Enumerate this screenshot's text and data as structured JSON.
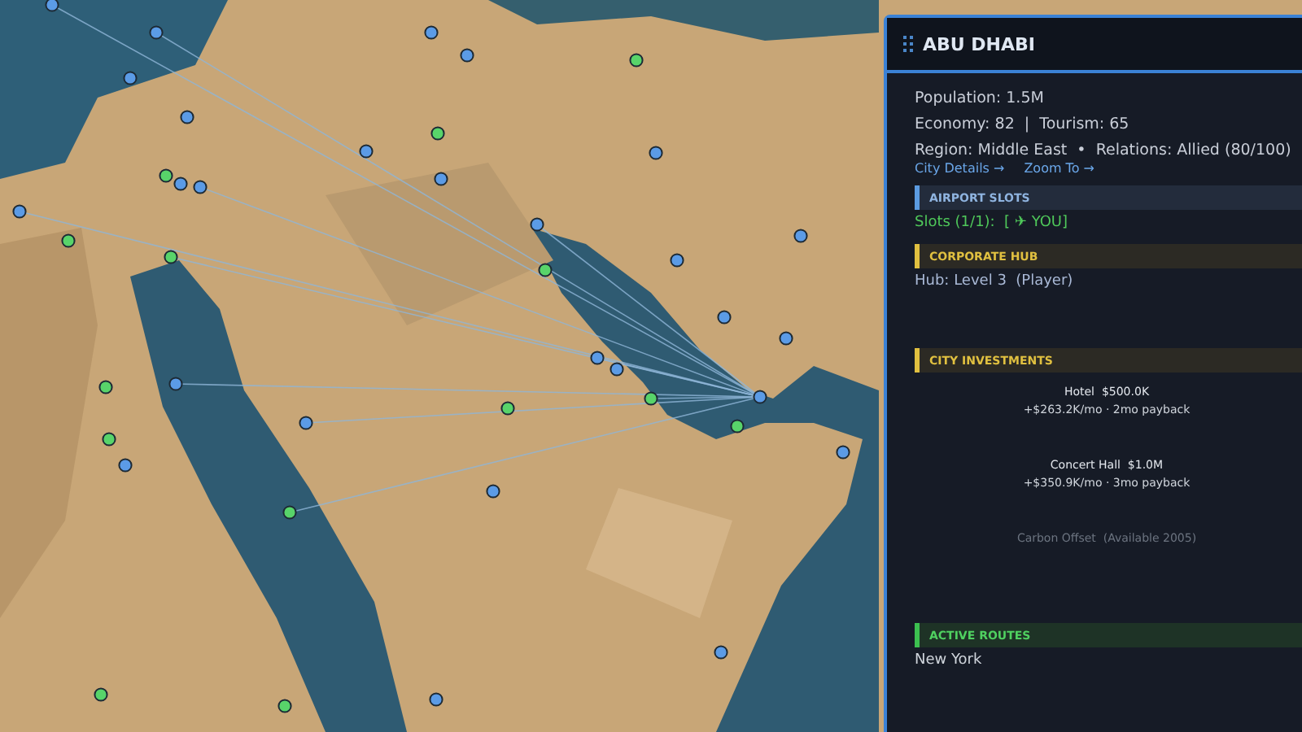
{
  "panel": {
    "title": "ABU DHABI",
    "stats": [
      "Population: 1.5M",
      "Economy: 82  |  Tourism: 65",
      "Region: Middle East  •  Relations: Allied (80/100)"
    ],
    "links": [
      "City Details →",
      "Zoom To →"
    ],
    "sections": [
      {
        "kind": "slots",
        "title": "AIRPORT SLOTS",
        "lines": [
          "Slots (1/1):  [ ✈ YOU]"
        ]
      },
      {
        "kind": "hub",
        "title": "CORPORATE HUB",
        "lines": [
          "Hub: Level 3  (Player)"
        ]
      },
      {
        "kind": "investments",
        "title": "CITY INVESTMENTS",
        "items": [
          {
            "name": "Hotel  $500.0K",
            "detail": "+$263.2K/mo · 2mo payback",
            "available": true
          },
          {
            "name": "Concert Hall  $1.0M",
            "detail": "+$350.9K/mo · 3mo payback",
            "available": true
          },
          {
            "name": "Carbon Offset  (Available 2005)",
            "available": false
          }
        ]
      },
      {
        "kind": "routes",
        "title": "ACTIVE ROUTES",
        "lines": [
          "New York"
        ]
      }
    ]
  }
}
